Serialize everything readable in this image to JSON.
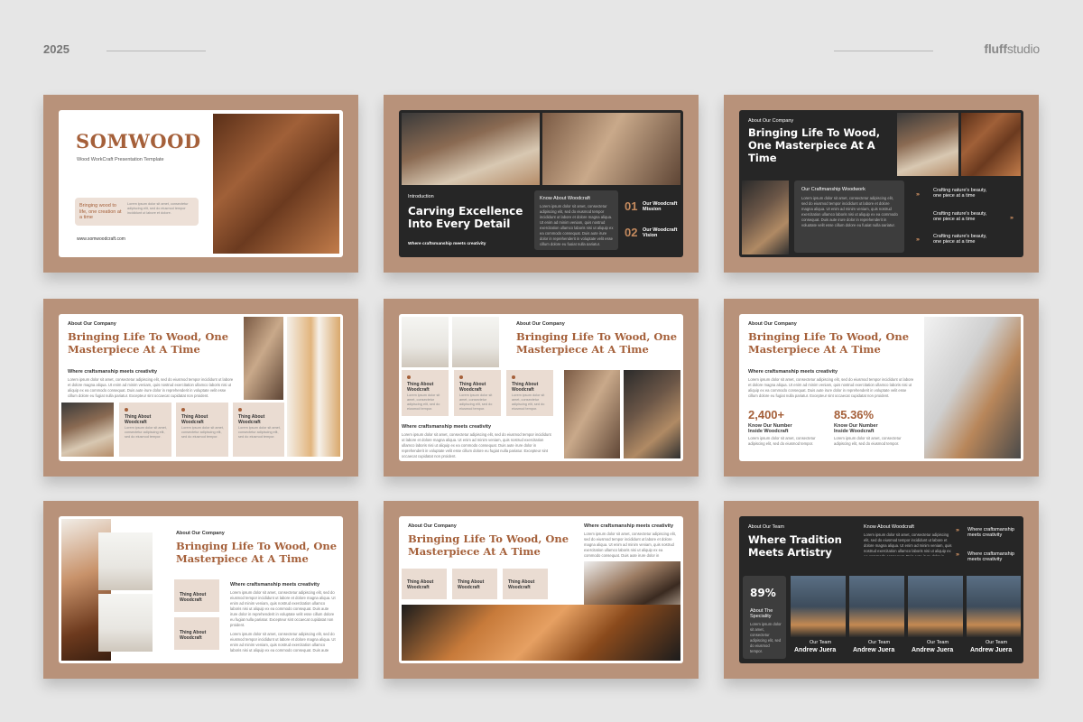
{
  "header": {
    "year": "2025",
    "brand_bold": "fluff",
    "brand_light": "studio"
  },
  "lorem": "Lorem ipsum dolor sit amet, consectetur adipiscing elit, sed do eiusmod tempor incididunt ut labore et dolore magna aliqua. Ut enim ad minim veniam, quis nostrud exercitation ullamco laboris nisi ut aliquip ex ea commodo consequat. Duis aute irure dolor in reprehenderit in voluptate velit esse cillum dolore eu fugiat nulla pariatur. Excepteur sint occaecat cupidatat non proident.",
  "lorem_short": "Lorem ipsum dolor sit amet, consectetur adipiscing elit, sed do eiusmod tempor.",
  "s1": {
    "title": "SOMWOOD",
    "subtitle": "Wood WorkCraft Presentation Template",
    "tagline": "Bringing wood to life, one creation at a time",
    "body": "Lorem ipsum dolor sit amet, consectetur adipiscing elit, sed do eiusmod tempor incididunt ut labore et dolore.",
    "url": "www.somwoodcraft.com"
  },
  "s2": {
    "kicker": "Introduction",
    "title": "Carving Excellence Into Every Detail",
    "sub": "Where craftsmanship meets creativity",
    "panel_title": "Know About Woodcraft",
    "items": [
      {
        "num": "01",
        "label": "Our Woodcraft Mission"
      },
      {
        "num": "02",
        "label": "Our Woodcraft Vision"
      }
    ]
  },
  "s3": {
    "kicker": "About Our Company",
    "title": "Bringing Life To Wood, One Masterpiece At A Time",
    "panel_title": "Our Craftmanship Woodwork",
    "rows": [
      "Crafting nature's beauty, one piece at a time",
      "Crafting nature's beauty, one piece at a time",
      "Crafting nature's beauty, one piece at a time"
    ]
  },
  "s4": {
    "kicker": "About Our Company",
    "title": "Bringing Life To Wood, One Masterpiece At A Time",
    "sub": "Where craftsmanship meets creativity",
    "tiles": [
      "Thing About Woodcraft",
      "Thing About Woodcraft",
      "Thing About Woodcraft"
    ]
  },
  "s5": {
    "kicker": "About Our Company",
    "title": "Bringing Life To Wood, One Masterpiece At A Time",
    "sub": "Where craftsmanship meets creativity",
    "tiles": [
      "Thing About Woodcraft",
      "Thing About Woodcraft",
      "Thing About Woodcraft"
    ]
  },
  "s6": {
    "kicker": "About Our Company",
    "title": "Bringing Life To Wood, One Masterpiece At A Time",
    "sub": "Where craftsmanship meets creativity",
    "stats": [
      {
        "value": "2,400+",
        "label": "Know Our Number Inside Woodcraft"
      },
      {
        "value": "85.36%",
        "label": "Know Our Number Inside Woodcraft"
      }
    ]
  },
  "s7": {
    "kicker": "About Our Company",
    "title": "Bringing Life To Wood, One Masterpiece At A Time",
    "sub": "Where craftsmanship meets creativity",
    "tiles": [
      "Thing About Woodcraft",
      "Thing About Woodcraft"
    ]
  },
  "s8": {
    "kicker": "About Our Company",
    "title": "Bringing Life To Wood, One Masterpiece At A Time",
    "sub": "Where craftsmanship meets creativity",
    "tiles": [
      "Thing About Woodcraft",
      "Thing About Woodcraft",
      "Thing About Woodcraft"
    ]
  },
  "s9": {
    "kicker": "About Our Team",
    "title": "Where Tradition Meets Artistry",
    "panel_title": "Know About Woodcraft",
    "right_rows": [
      "Where craftsmanship meets creativity",
      "Where craftsmanship meets creativity"
    ],
    "stat": {
      "value": "89%",
      "label": "About The Speciality"
    },
    "team": [
      {
        "role": "Our Team",
        "name": "Andrew Juera"
      },
      {
        "role": "Our Team",
        "name": "Andrew Juera"
      },
      {
        "role": "Our Team",
        "name": "Andrew Juera"
      },
      {
        "role": "Our Team",
        "name": "Andrew Juera"
      }
    ]
  }
}
